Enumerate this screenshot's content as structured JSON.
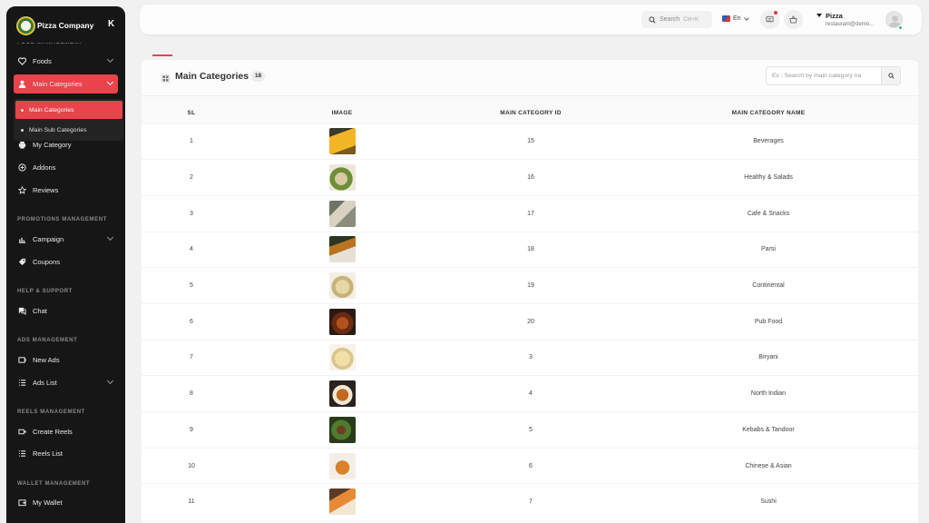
{
  "brand": {
    "name": "Pizza Company",
    "collapse_label": "K"
  },
  "sidebar": {
    "sections": {
      "food": "FOOD MANAGEMENT",
      "promotions": "PROMOTIONS MANAGEMENT",
      "help": "HELP & SUPPORT",
      "ads": "ADS MANAGEMENT",
      "reels": "REELS MANAGEMENT",
      "wallet": "WALLET MANAGEMENT"
    },
    "items": {
      "foods": "Foods",
      "main_categories": "Main Categories",
      "my_category": "My Category",
      "addons": "Addons",
      "reviews": "Reviews",
      "campaign": "Campaign",
      "coupons": "Coupons",
      "chat": "Chat",
      "new_ads": "New Ads",
      "ads_list": "Ads List",
      "create_reels": "Create Reels",
      "reels_list": "Reels List",
      "my_wallet": "My Wallet"
    },
    "sub_items": {
      "main_categories": "Main Categories",
      "main_sub_categories": "Main Sub Categories"
    }
  },
  "topbar": {
    "search_label": "Search",
    "search_shortcut": "Ctrl+K",
    "language": "En",
    "user_name": "Pizza",
    "user_email": "restaurant@demo..."
  },
  "page": {
    "title": "Main Categories",
    "count": "18",
    "search_placeholder": "Ex : Search by main category na"
  },
  "table": {
    "columns": [
      "SL",
      "IMAGE",
      "MAIN CATEGORY ID",
      "MAIN CATEGORY NAME"
    ],
    "rows": [
      {
        "sl": "1",
        "id": "15",
        "name": "Beverages"
      },
      {
        "sl": "2",
        "id": "16",
        "name": "Healthy & Salads"
      },
      {
        "sl": "3",
        "id": "17",
        "name": "Cafe & Snacks"
      },
      {
        "sl": "4",
        "id": "18",
        "name": "Parsi"
      },
      {
        "sl": "5",
        "id": "19",
        "name": "Continental"
      },
      {
        "sl": "6",
        "id": "20",
        "name": "Pub Food"
      },
      {
        "sl": "7",
        "id": "3",
        "name": "Biryani"
      },
      {
        "sl": "8",
        "id": "4",
        "name": "North Indian"
      },
      {
        "sl": "9",
        "id": "5",
        "name": "Kebabs & Tandoor"
      },
      {
        "sl": "10",
        "id": "6",
        "name": "Chinese & Asian"
      },
      {
        "sl": "11",
        "id": "7",
        "name": "Sushi"
      }
    ]
  },
  "colors": {
    "accent": "#e9434b",
    "sidebar_bg": "#161616",
    "online": "#2ec26a"
  }
}
